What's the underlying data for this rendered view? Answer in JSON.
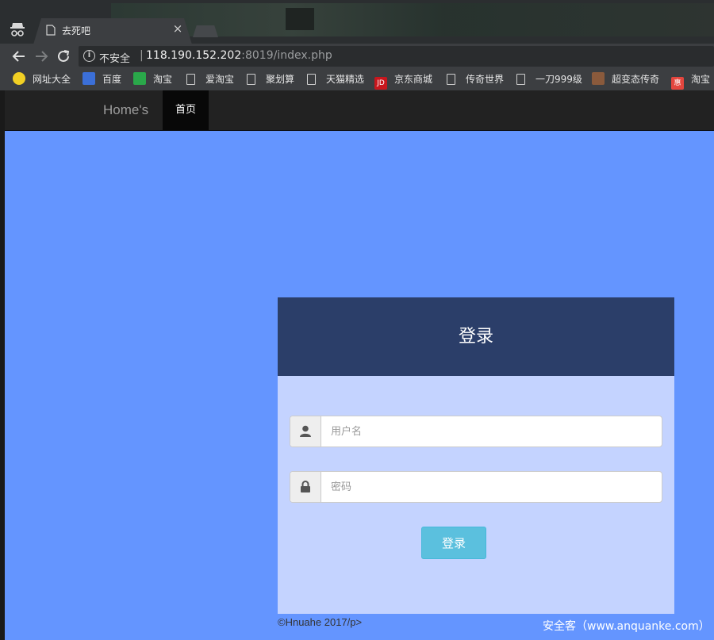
{
  "browser": {
    "tab_title": "去死吧",
    "tab_close": "×",
    "security_label": "不安全",
    "separator": "|",
    "url_host": "118.190.152.202",
    "url_rest": ":8019/index.php"
  },
  "bookmarks": [
    {
      "label": "网址大全",
      "icon": "hao123-icon",
      "color": "#f2d024"
    },
    {
      "label": "百度",
      "icon": "baidu-icon",
      "color": "#3b6fd8"
    },
    {
      "label": "淘宝",
      "icon": "taobao-icon",
      "color": "#2aa84a"
    },
    {
      "label": "爱淘宝",
      "icon": "page-icon"
    },
    {
      "label": "聚划算",
      "icon": "page-icon"
    },
    {
      "label": "天猫精选",
      "icon": "page-icon"
    },
    {
      "label": "京东商城",
      "icon": "jd-icon",
      "color": "#c8161d",
      "icon_text": "JD"
    },
    {
      "label": "传奇世界",
      "icon": "page-icon"
    },
    {
      "label": "一刀999级",
      "icon": "page-icon"
    },
    {
      "label": "超变态传奇",
      "icon": "avatar-icon",
      "color": "#8a5a3c"
    },
    {
      "label": "淘宝",
      "icon": "taobao-red-icon",
      "color": "#e4463e",
      "icon_text": "惠"
    }
  ],
  "navbar": {
    "brand": "Home's",
    "active_item": "首页"
  },
  "login": {
    "title": "登录",
    "username_placeholder": "用户名",
    "password_placeholder": "密码",
    "submit_label": "登录"
  },
  "footer": {
    "copyright": "©Hnuahe 2017/p>",
    "watermark": "安全客（www.anquanke.com）"
  },
  "colors": {
    "page_bg": "#6495ff",
    "card_bg": "#c4d3ff",
    "card_header": "#2b3e69",
    "button": "#5bc0de"
  }
}
